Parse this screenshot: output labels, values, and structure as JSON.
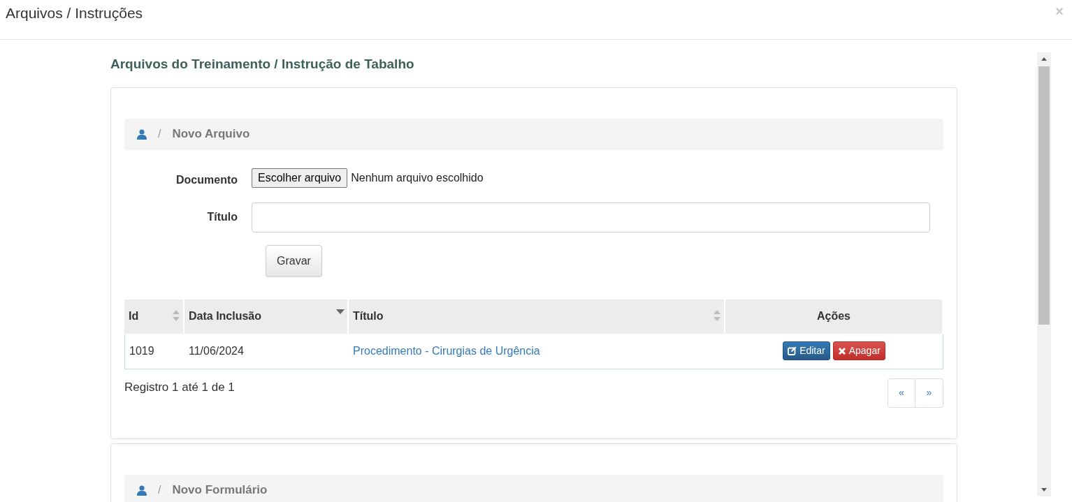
{
  "window": {
    "title": "Arquivos / Instruções",
    "close": "×"
  },
  "heading": "Arquivos do Treinamento / Instrução de Tabalho",
  "sections": [
    {
      "kind": "file_form",
      "breadcrumb": {
        "separator": "/",
        "label": "Novo Arquivo"
      },
      "form": {
        "document_label": "Documento",
        "file_button": "Escolher arquivo",
        "file_status": "Nenhum arquivo escolhido",
        "title_label": "Título",
        "save_button": "Gravar"
      },
      "table": {
        "columns": [
          {
            "label": "Id",
            "sortable": true,
            "sorted_descending": false
          },
          {
            "label": "Data Inclusão",
            "sortable": true,
            "sorted_descending": true
          },
          {
            "label": "Título",
            "sortable": true,
            "sorted_descending": false
          },
          {
            "label": "Ações",
            "sortable": false
          }
        ],
        "rows": [
          {
            "id": "1019",
            "date": "11/06/2024",
            "title": "Procedimento - Cirurgias de Urgência",
            "actions": [
              {
                "kind": "edit",
                "label": "Editar"
              },
              {
                "kind": "delete",
                "label": "Apagar"
              }
            ]
          }
        ]
      },
      "summary": "Registro 1 até 1 de 1",
      "pagination": [
        "«",
        "»"
      ]
    },
    {
      "kind": "header_only",
      "breadcrumb": {
        "separator": "/",
        "label": "Novo Formulário"
      }
    }
  ]
}
